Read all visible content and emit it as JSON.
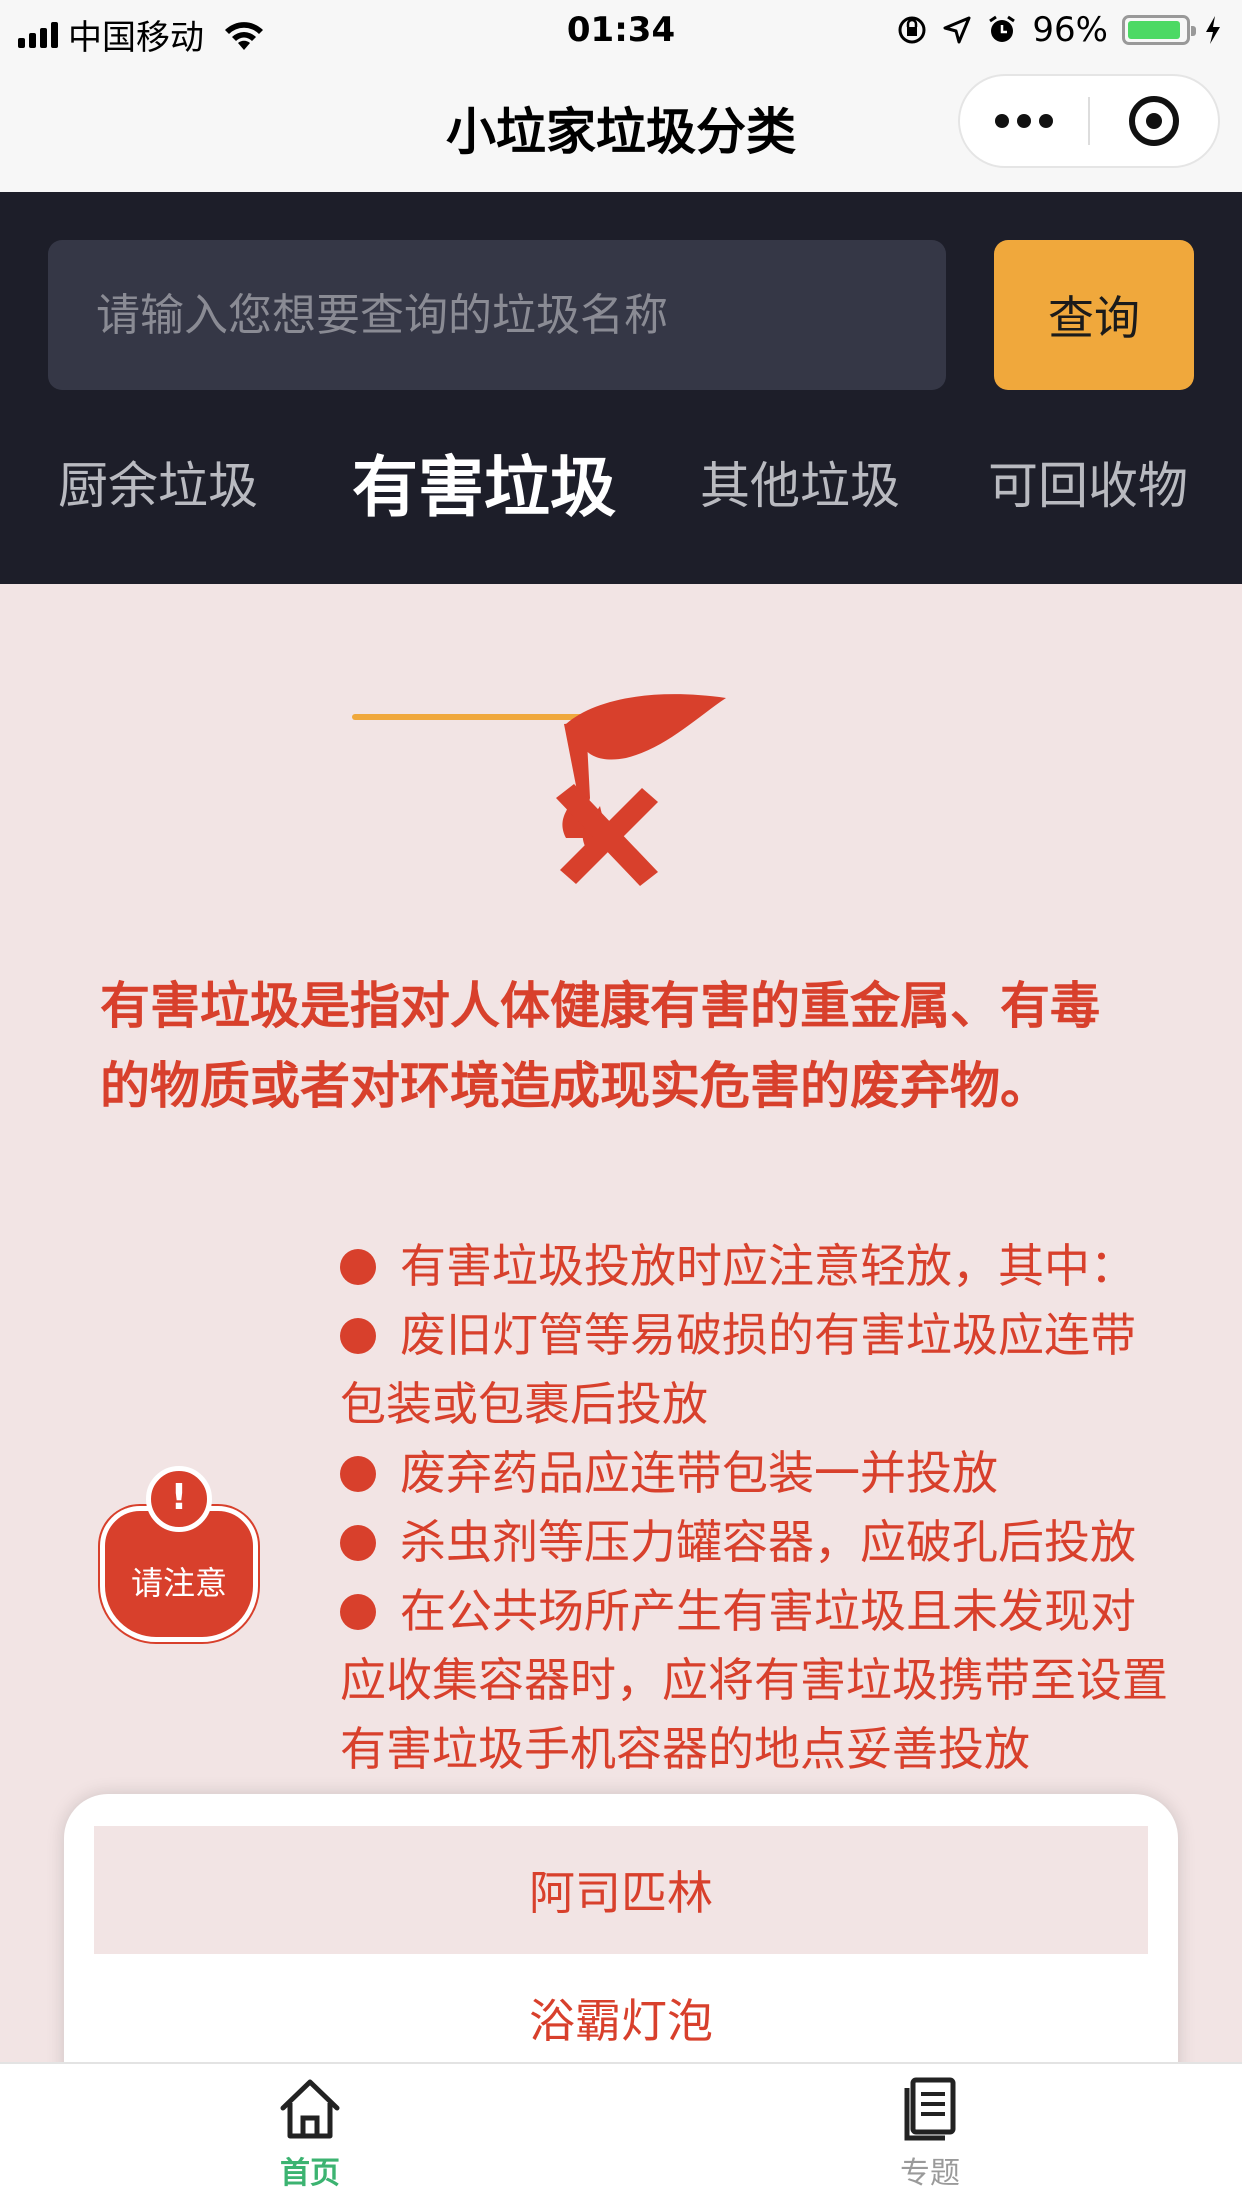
{
  "status_bar": {
    "carrier": "中国移动",
    "time": "01:34",
    "battery_percent": "96%",
    "battery_level": 0.96
  },
  "nav": {
    "title": "小垃家垃圾分类",
    "more_icon": "more-dots-icon",
    "close_icon": "target-close-icon"
  },
  "search": {
    "placeholder": "请输入您想要查询的垃圾名称",
    "value": "",
    "button_label": "查询"
  },
  "tabs": [
    {
      "label": "厨余垃圾",
      "active": false
    },
    {
      "label": "有害垃圾",
      "active": true
    },
    {
      "label": "其他垃圾",
      "active": false
    },
    {
      "label": "可回收物",
      "active": false
    }
  ],
  "colors": {
    "accent": "#f0a83c",
    "hazard_red": "#d8402c",
    "header_bg": "#1d1e29",
    "page_bg": "#f2e4e4",
    "tab_active_green": "#3cb371"
  },
  "category": {
    "icon": "hazardous-waste-icon",
    "description": "有害垃圾是指对人体健康有害的重金属、有毒的物质或者对环境造成现实危害的废弃物。",
    "notes": [
      "有害垃圾投放时应注意轻放，其中：",
      "废旧灯管等易破损的有害垃圾应连带包装或包裹后投放",
      "废弃药品应连带包装一并投放",
      "杀虫剂等压力罐容器，应破孔后投放",
      "在公共场所产生有害垃圾且未发现对应收集容器时，应将有害垃圾携带至设置有害垃圾手机容器的地点妥善投放"
    ],
    "attention": {
      "mark": "!",
      "label": "请注意"
    }
  },
  "suggestions": [
    "阿司匹林",
    "浴霸灯泡"
  ],
  "tabbar": {
    "home": {
      "label": "首页",
      "icon": "home-icon"
    },
    "topics": {
      "label": "专题",
      "icon": "document-list-icon"
    }
  }
}
